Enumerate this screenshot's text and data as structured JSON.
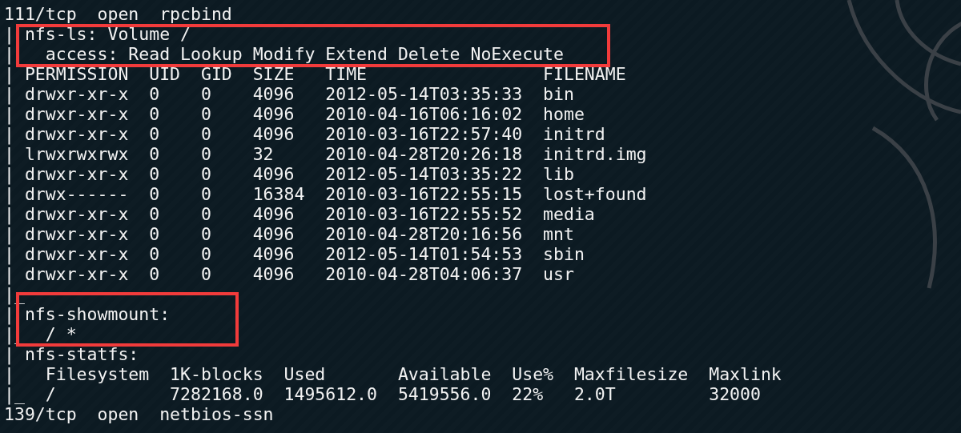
{
  "terminal": {
    "blocks": [
      {
        "highlighted": false,
        "lines": [
          "111/tcp  open  rpcbind"
        ]
      },
      {
        "highlighted": true,
        "lines": [
          "| nfs-ls: Volume /",
          "|   access: Read Lookup Modify Extend Delete NoExecute"
        ]
      },
      {
        "highlighted": false,
        "lines": [
          "| PERMISSION  UID  GID  SIZE   TIME                 FILENAME",
          "| drwxr-xr-x  0    0    4096   2012-05-14T03:35:33  bin",
          "| drwxr-xr-x  0    0    4096   2010-04-16T06:16:02  home",
          "| drwxr-xr-x  0    0    4096   2010-03-16T22:57:40  initrd",
          "| lrwxrwxrwx  0    0    32     2010-04-28T20:26:18  initrd.img",
          "| drwxr-xr-x  0    0    4096   2012-05-14T03:35:22  lib",
          "| drwx------  0    0    16384  2010-03-16T22:55:15  lost+found",
          "| drwxr-xr-x  0    0    4096   2010-03-16T22:55:52  media",
          "| drwxr-xr-x  0    0    4096   2010-04-28T20:16:56  mnt",
          "| drwxr-xr-x  0    0    4096   2012-05-14T01:54:53  sbin",
          "| drwxr-xr-x  0    0    4096   2010-04-28T04:06:37  usr"
        ]
      },
      {
        "highlighted": true,
        "lines": [
          "|_",
          "| nfs-showmount:",
          "|_  / *"
        ]
      },
      {
        "highlighted": false,
        "lines": [
          "| nfs-statfs:",
          "|   Filesystem  1K-blocks  Used       Available  Use%  Maxfilesize  Maxlink",
          "|_  /           7282168.0  1495612.0  5419556.0  22%   2.0T         32000",
          "139/tcp  open  netbios-ssn"
        ]
      }
    ]
  }
}
